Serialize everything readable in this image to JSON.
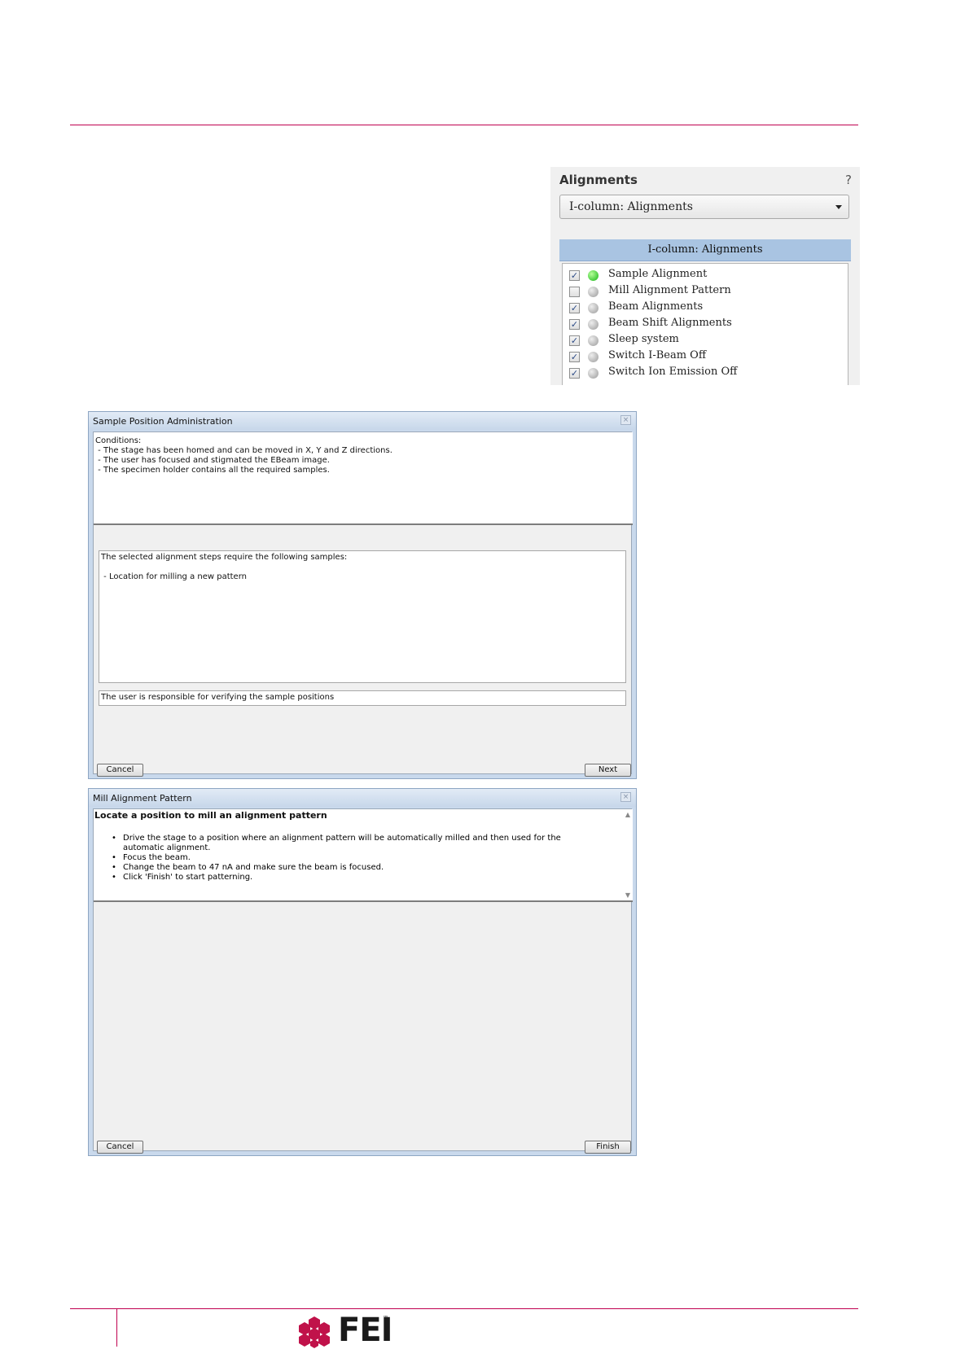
{
  "alignments_panel": {
    "title": "Alignments",
    "help": "?",
    "select_value": "I-column: Alignments",
    "list_header": "I-column: Alignments",
    "items": [
      {
        "label": "Sample Alignment",
        "checked": true,
        "status": "green"
      },
      {
        "label": "Mill Alignment Pattern",
        "checked": false,
        "status": "grey"
      },
      {
        "label": "Beam Alignments",
        "checked": true,
        "status": "grey"
      },
      {
        "label": "Beam Shift Alignments",
        "checked": true,
        "status": "grey"
      },
      {
        "label": "Sleep system",
        "checked": true,
        "status": "grey"
      },
      {
        "label": "Switch I-Beam Off",
        "checked": true,
        "status": "grey"
      },
      {
        "label": "Switch Ion Emission Off",
        "checked": true,
        "status": "grey"
      }
    ]
  },
  "sample_dialog": {
    "title": "Sample Position Administration",
    "conditions": "Conditions:\n - The stage has been homed and can be moved in X, Y and Z directions.\n - The user has focused and stigmated the EBeam image.\n - The specimen holder contains all the required samples.",
    "samples_text": "The selected alignment steps require the following samples:\n\n - Location for milling a new pattern",
    "responsibility": "The user is responsible for verifying the sample positions",
    "cancel_label": "Cancel",
    "next_label": "Next"
  },
  "mill_dialog": {
    "title": "Mill Alignment Pattern",
    "heading": "Locate a position to mill an alignment pattern",
    "bullets": [
      "Drive the stage to a position where an alignment pattern will be automatically milled and then used for the automatic alignment.",
      "Focus the beam.",
      "Change the beam to 47 nA and make sure the beam is focused.",
      "Click 'Finish' to start patterning."
    ],
    "cancel_label": "Cancel",
    "finish_label": "Finish"
  },
  "footer": {
    "logo_text": "FEI",
    "logo_tm": "™"
  },
  "colors": {
    "rule": "#c0004f",
    "logo_hex": "#c0124a",
    "list_header": "#a9c4e2"
  }
}
